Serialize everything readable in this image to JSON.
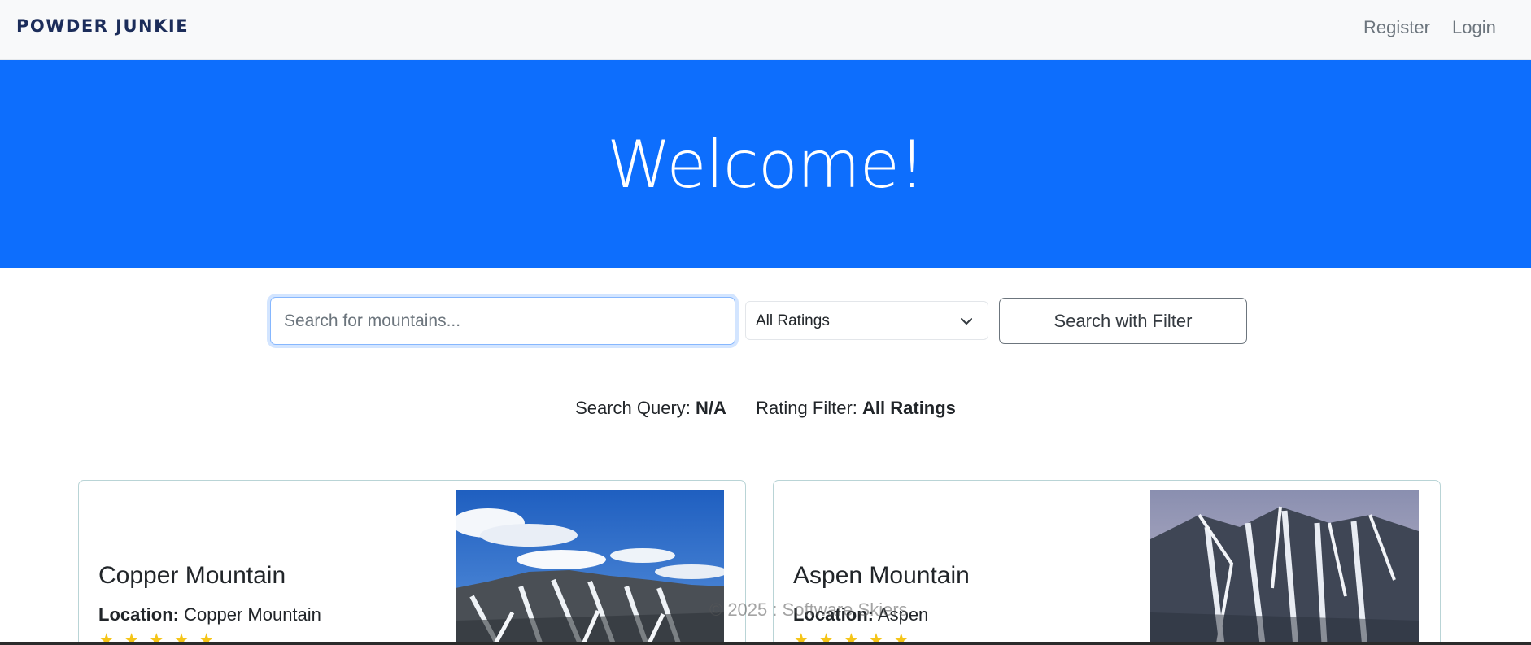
{
  "navbar": {
    "brand": "POWDER JUNKIE",
    "links": [
      {
        "label": "Register"
      },
      {
        "label": "Login"
      }
    ]
  },
  "hero": {
    "title": "Welcome!"
  },
  "search": {
    "placeholder": "Search for mountains...",
    "value": "",
    "rating_select": {
      "selected": "All Ratings",
      "icon": "chevron-down-icon"
    },
    "filter_button_label": "Search with Filter"
  },
  "summary": {
    "query_label": "Search Query:",
    "query_value": "N/A",
    "rating_label": "Rating Filter:",
    "rating_value": "All Ratings"
  },
  "cards": [
    {
      "title": "Copper Mountain",
      "location_label": "Location:",
      "location_value": "Copper Mountain",
      "stars": "★★★★★",
      "image": "mountain-photo-copper"
    },
    {
      "title": "Aspen Mountain",
      "location_label": "Location:",
      "location_value": "Aspen",
      "stars": "★★★★★",
      "image": "mountain-photo-aspen"
    }
  ],
  "footer": {
    "text": "© 2025 : Software Skiers"
  },
  "colors": {
    "hero_bg": "#0d6efd",
    "navbar_bg": "#f8f9fa",
    "brand": "#1c2d5a",
    "star": "#f5c518",
    "card_border": "#b9d4d6"
  }
}
